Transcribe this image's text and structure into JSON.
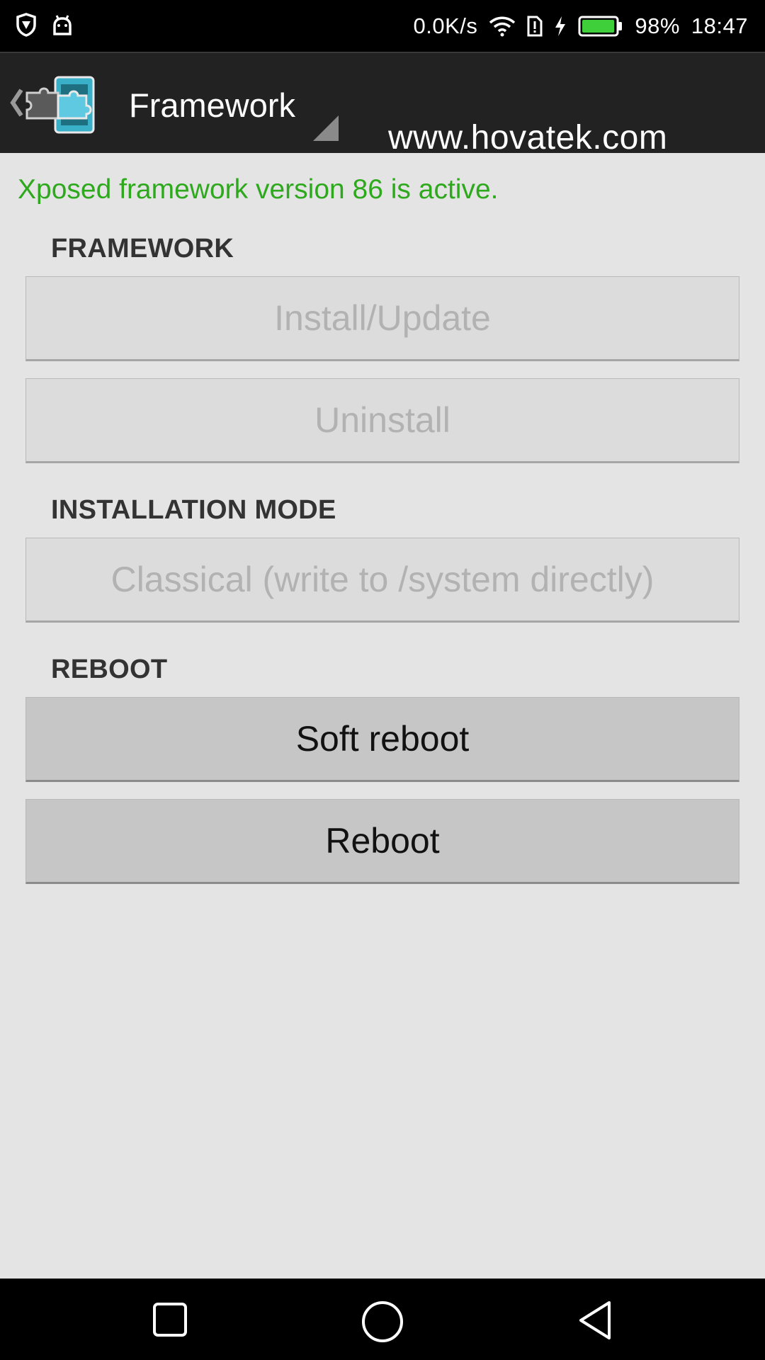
{
  "status_bar": {
    "icons_left": [
      "shield-icon",
      "android-icon"
    ],
    "network_speed": "0.0K/s",
    "icons_right": [
      "wifi-icon",
      "sim-alert-icon",
      "charging-icon",
      "battery-icon"
    ],
    "battery_level_percent": 98,
    "battery_text": "98%",
    "time": "18:47"
  },
  "action_bar": {
    "title": "Framework",
    "watermark": "www.hovatek.com",
    "app_icon": "xposed-puzzle-icon"
  },
  "main": {
    "status_text": "Xposed framework version 86 is active.",
    "sections": {
      "framework": {
        "header": "FRAMEWORK",
        "install_label": "Install/Update",
        "uninstall_label": "Uninstall"
      },
      "installation_mode": {
        "header": "INSTALLATION MODE",
        "mode_label": "Classical (write to /system directly)"
      },
      "reboot": {
        "header": "REBOOT",
        "soft_reboot_label": "Soft reboot",
        "reboot_label": "Reboot"
      }
    }
  },
  "nav_bar": {
    "buttons": [
      "recents-icon",
      "home-icon",
      "back-icon"
    ]
  },
  "colors": {
    "status_active": "#2ea91d",
    "action_bar_bg": "#222222",
    "content_bg": "#e4e4e4",
    "battery_fill": "#3fcf3a"
  }
}
